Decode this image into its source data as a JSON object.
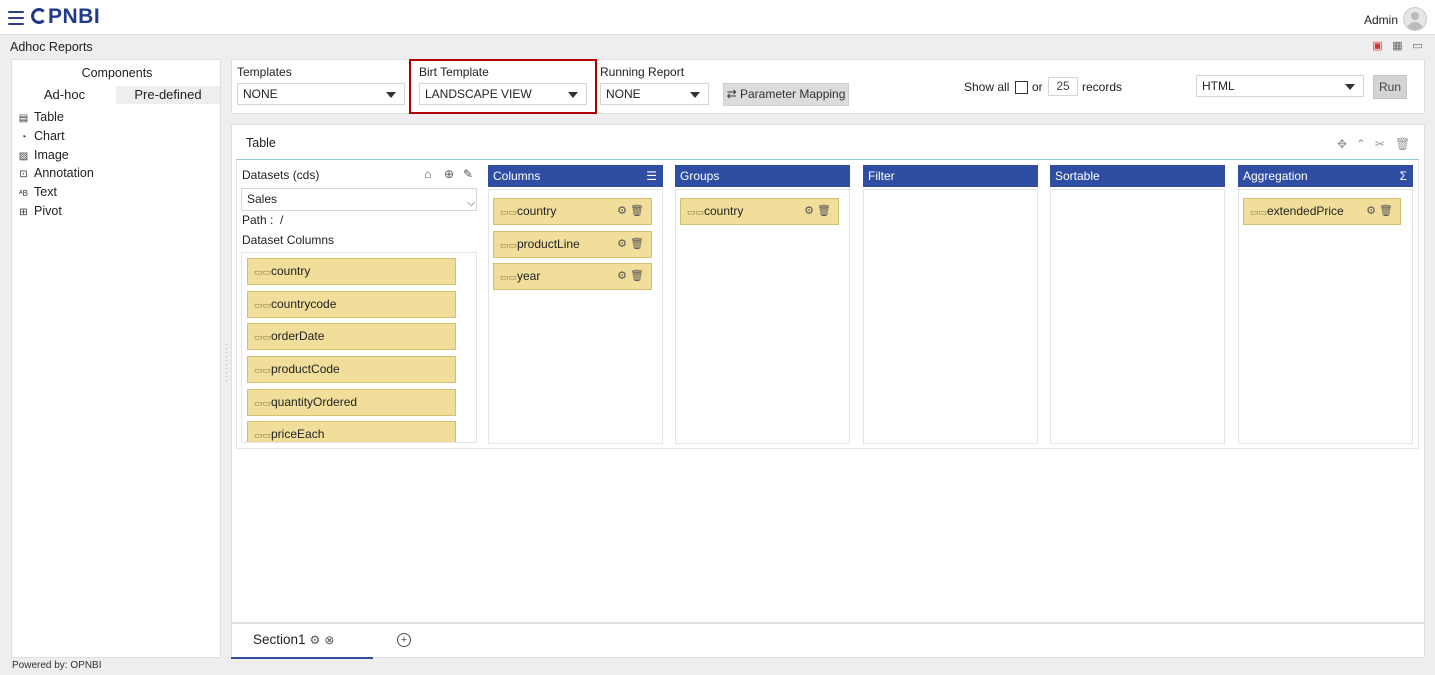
{
  "app": {
    "logo_text": "PNBI",
    "user": "Admin",
    "page_title": "Adhoc Reports",
    "footer": "Powered by: OPNBI"
  },
  "components": {
    "title": "Components",
    "tabs": [
      "Ad-hoc",
      "Pre-defined"
    ],
    "items": [
      {
        "label": "Table",
        "icon": "table-icon"
      },
      {
        "label": "Chart",
        "icon": "chart-icon"
      },
      {
        "label": "Image",
        "icon": "image-icon"
      },
      {
        "label": "Annotation",
        "icon": "annotation-icon"
      },
      {
        "label": "Text",
        "icon": "text-icon"
      },
      {
        "label": "Pivot",
        "icon": "pivot-icon"
      }
    ]
  },
  "toolbar": {
    "templates_label": "Templates",
    "templates_value": "NONE",
    "birt_label": "Birt Template",
    "birt_value": "LANDSCAPE VIEW",
    "running_label": "Running Report",
    "running_value": "NONE",
    "param_button": "Parameter Mapping",
    "show_all": "Show all",
    "or": "or",
    "records_count": "25",
    "records": "records",
    "format_value": "HTML",
    "run_button": "Run"
  },
  "table_panel": {
    "title": "Table",
    "datasets_label": "Datasets (cds)",
    "dataset_value": "Sales",
    "path_label": "Path :",
    "path_value": "/",
    "dataset_columns_label": "Dataset Columns",
    "dataset_columns": [
      "country",
      "countrycode",
      "orderDate",
      "productCode",
      "quantityOrdered",
      "priceEach"
    ],
    "columns_header": "Columns",
    "columns": [
      "country",
      "productLine",
      "year"
    ],
    "groups_header": "Groups",
    "groups": [
      "country"
    ],
    "filter_header": "Filter",
    "sortable_header": "Sortable",
    "aggregation_header": "Aggregation",
    "aggregation": [
      "extendedPrice"
    ]
  },
  "sections": {
    "tab_label": "Section1"
  },
  "colors": {
    "accent": "#2f4ea3",
    "chip": "#f0de9a",
    "highlight": "#b00000"
  }
}
